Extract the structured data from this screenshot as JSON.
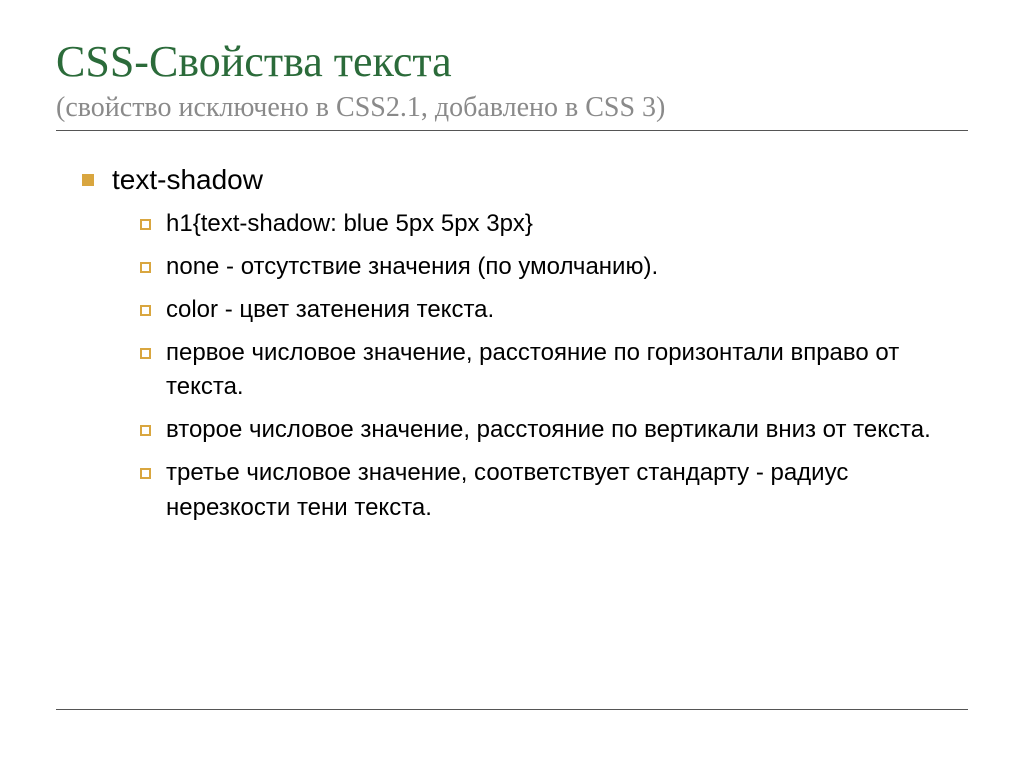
{
  "title": {
    "main": "CSS-Свойства текста",
    "sub": "(свойство исключено в CSS2.1, добавлено в CSS 3)"
  },
  "content": {
    "item": "text-shadow",
    "subitems": [
      "h1{text-shadow: blue 5px 5px 3px}",
      "none - отсутствие значения (по умолчанию).",
      "color - цвет затенения текста.",
      "первое числовое значение, расстояние по горизонтали вправо от текста.",
      "второе числовое значение, расстояние по вертикали вниз от текста.",
      "третье числовое значение, соответствует стандарту - радиус нерезкости тени текста."
    ]
  }
}
